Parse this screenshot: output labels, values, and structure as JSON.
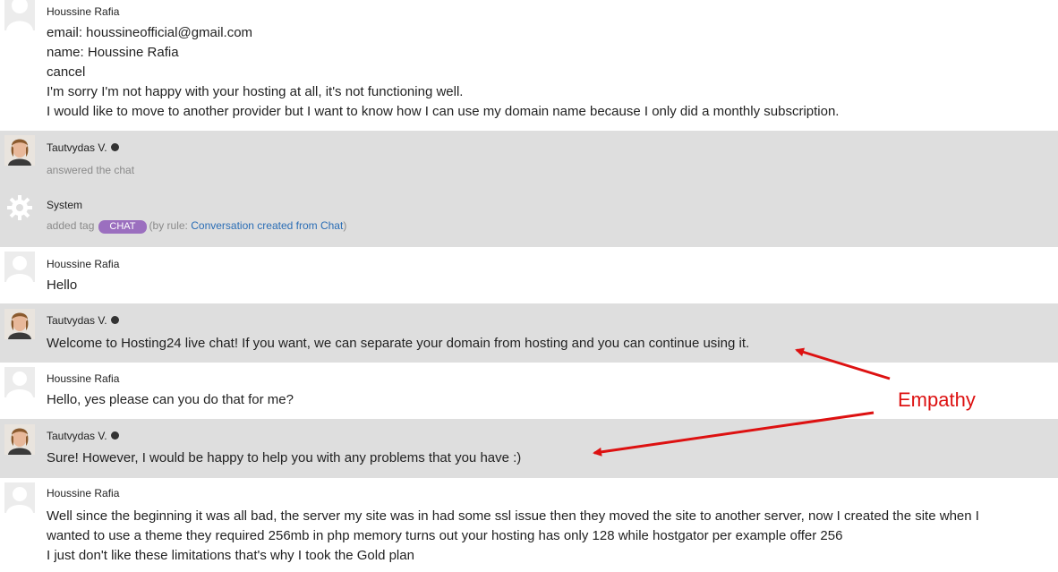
{
  "messages": [
    {
      "author": "Houssine Rafia",
      "lines": [
        "email: houssineofficial@gmail.com",
        "name: Houssine Rafia",
        "cancel",
        "I'm sorry I'm not happy with your hosting at all, it's not functioning well.",
        "I would like to move to another provider but I want to know how I can use my domain name because I only did a monthly subscription."
      ]
    },
    {
      "author": "Tautvydas V.",
      "event": "answered the chat"
    },
    {
      "author": "System",
      "event_prefix": "added tag",
      "tag": "CHAT",
      "rule_prefix": "(by rule:",
      "rule_link": "Conversation created from Chat",
      "rule_suffix": ")"
    },
    {
      "author": "Houssine Rafia",
      "lines": [
        "Hello"
      ]
    },
    {
      "author": "Tautvydas V.",
      "lines": [
        "Welcome to Hosting24 live chat! If you want, we can separate your domain from hosting and you can continue using it."
      ]
    },
    {
      "author": "Houssine Rafia",
      "lines": [
        "Hello, yes please can you do that for me?"
      ]
    },
    {
      "author": "Tautvydas V.",
      "lines": [
        "Sure! However, I would be happy to help you with any problems that you have :)"
      ]
    },
    {
      "author": "Houssine Rafia",
      "lines": [
        "Well since the beginning it was all bad, the server my site was in had some ssl issue then they moved the site to another server, now I created the site when I",
        "wanted to use a theme they required 256mb in php memory turns out your hosting has only 128 while hostgator per example offer 256",
        "I just don't like these limitations that's why I took the Gold plan"
      ]
    }
  ],
  "annotation": {
    "label": "Empathy",
    "color": "#dd1111"
  },
  "colors": {
    "agent_row_bg": "#dedede",
    "customer_row_bg": "#ffffff",
    "tag_bg": "#9b6fbf",
    "link": "#2a6db5"
  }
}
